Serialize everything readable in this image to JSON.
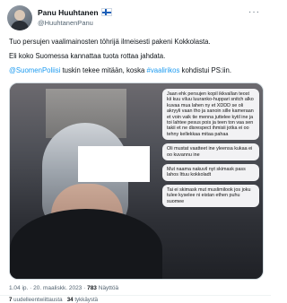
{
  "author": {
    "name": "Panu Huuhtanen",
    "handle": "@HuuhtanenPanu"
  },
  "tweet": {
    "line1": "Tuo persujen vaalimainosten töhrijä ilmeisesti pakeni Kokkolasta.",
    "line2": "Eli koko Suomessa kannattaa tuota rottaa jahdata.",
    "line3_mention": "@SuomenPoliisi",
    "line3_mid": " tuskin tekee mitään, koska ",
    "line3_hashtag": "#vaalirikos",
    "line3_end": " kohdistui PS:iin."
  },
  "chat_messages": [
    "Jaan ehk persujen kopil ikkvallan teost kii kuu viluu luuranko-huppari snitch alko kuvaa mua lahen ny et XDDD se oli akryyli vaan tho ja sanoin sille kameraan et voin vaik tie menna juttelee kytil ine ja toi lahtee pesus pois ja teen ton vaa sen takii et ne disrespect ihmisii jotka ei oo tehny kellekkaa mitaa pahaa",
    "Oli mustat vaatteet ine yleensa kukaa ei oo kuvannu ine",
    "Mut naama nakuvil nyt skimask pass lahos Ittuu kokkoladt",
    "Tai ei skimask mut muslimilook jos joku tulee kyselee ni eistan ethen puhu suomee"
  ],
  "meta": {
    "time": "1.04 ip. · 20. maaliskk. 2023 · ",
    "views_count": "783",
    "views_label": " Näyttöä"
  },
  "stats": {
    "retweets_count": "7",
    "retweets_label": " uudelleentwiittausta",
    "likes_count": "34",
    "likes_label": " tykkäystä"
  },
  "icons": {
    "more": "more-options-icon",
    "flag": "finland-flag-icon"
  }
}
